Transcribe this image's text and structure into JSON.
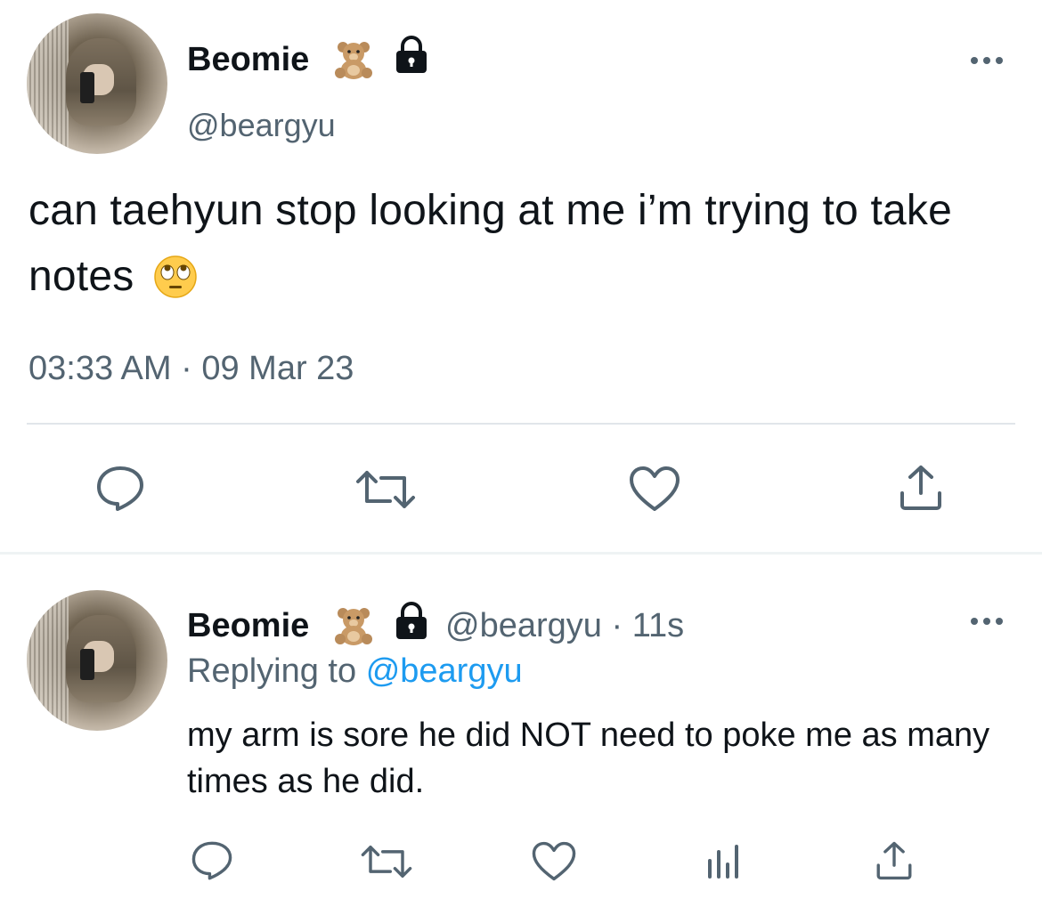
{
  "main_tweet": {
    "display_name": "Beomie",
    "name_emoji": "🧸",
    "handle": "@beargyu",
    "text": "can taehyun stop looking at me i’m trying to take notes",
    "text_emoji": "🙄",
    "time": "03:33 AM",
    "date": "09 Mar 23",
    "separator": "·"
  },
  "reply_tweet": {
    "display_name": "Beomie",
    "name_emoji": "🧸",
    "handle": "@beargyu",
    "separator": "·",
    "age": "11s",
    "replying_prefix": "Replying to",
    "replying_handle": "@beargyu",
    "text": "my arm is sore he did NOT need to poke me as many times as he did."
  },
  "icons": {
    "name_badge": "lock-icon",
    "more": "more-horizontal-icon",
    "actions": [
      "reply-icon",
      "retweet-icon",
      "like-icon",
      "share-icon"
    ],
    "reply_actions": [
      "reply-icon",
      "retweet-icon",
      "like-icon",
      "analytics-icon",
      "share-icon"
    ]
  },
  "colors": {
    "text": "#0f1419",
    "secondary": "#536471",
    "link": "#1d9bf0",
    "divider": "#e1e6ea"
  }
}
